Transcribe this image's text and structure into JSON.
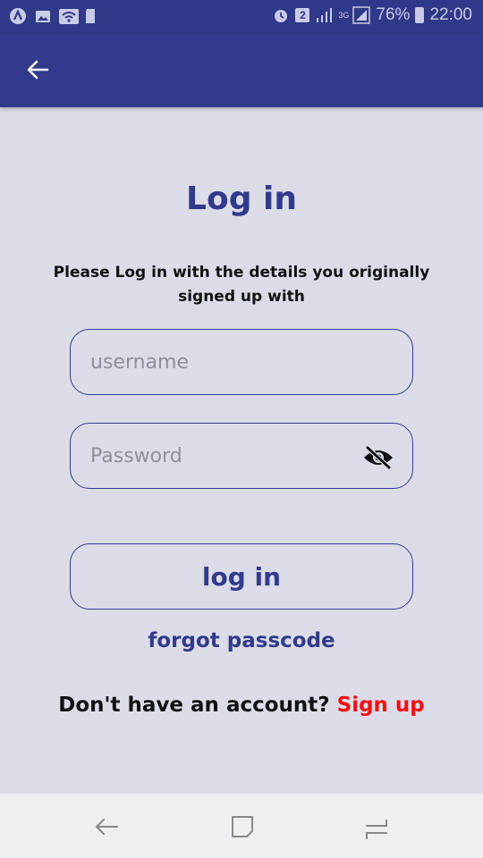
{
  "status_bar": {
    "battery": "76%",
    "time": "22:00",
    "sim_badge": "2",
    "network": "3G",
    "icons": [
      "app-a-icon",
      "gallery-icon",
      "wifi-icon",
      "sd-card-icon",
      "alarm-icon",
      "signal-icon",
      "battery-icon"
    ]
  },
  "appbar": {
    "back_icon": "arrow-left-icon"
  },
  "login": {
    "title": "Log in",
    "subtitle": "Please Log in with the details you originally signed up with",
    "username_placeholder": "username",
    "password_placeholder": "Password",
    "eye_icon": "eye-off-icon",
    "login_button": "log in",
    "forgot": "forgot passcode",
    "no_account": "Don't have an account? ",
    "signup": "Sign up"
  },
  "navbar": {
    "icons": [
      "back-nav-icon",
      "home-nav-icon",
      "recent-apps-icon"
    ]
  },
  "colors": {
    "primary": "#313a8c",
    "background": "#dcdce8",
    "accent_red": "#f01010"
  }
}
